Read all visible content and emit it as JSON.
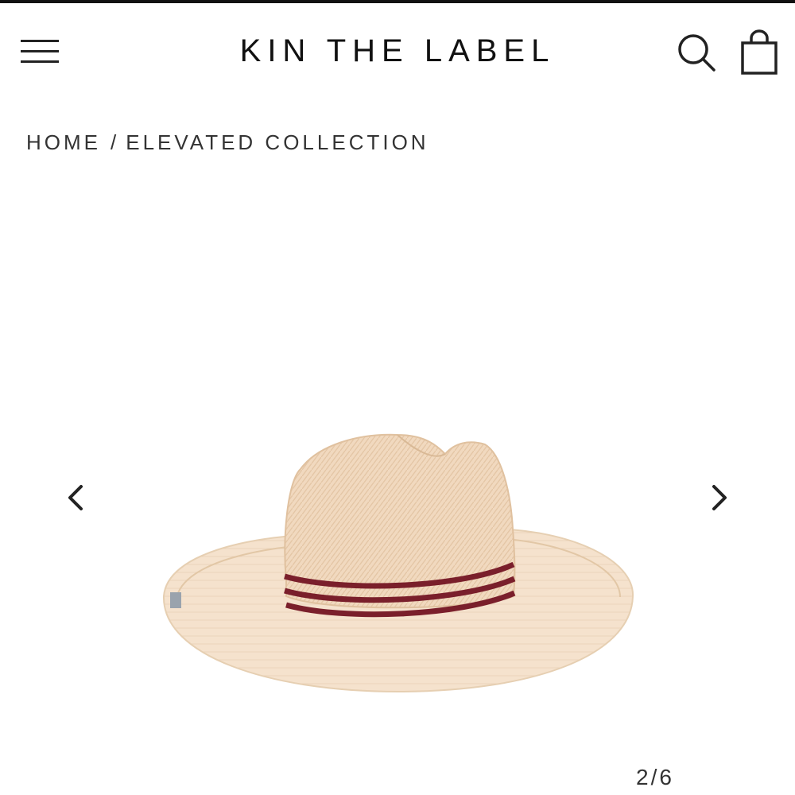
{
  "header": {
    "brand": "KIN THE LABEL",
    "menu_icon": "hamburger-menu-icon",
    "search_icon": "search-icon",
    "cart_icon": "shopping-bag-icon"
  },
  "breadcrumb": {
    "home": "HOME",
    "separator": "/",
    "current": "ELEVATED COLLECTION"
  },
  "gallery": {
    "prev_icon": "chevron-left-icon",
    "next_icon": "chevron-right-icon",
    "current_index": "2",
    "separator": "/",
    "total": "6",
    "image": "straw-fedora-hat-with-burgundy-bands"
  },
  "colors": {
    "straw": "#f3dcc3",
    "band": "#7a1f2b",
    "text": "#1a1a1a"
  }
}
